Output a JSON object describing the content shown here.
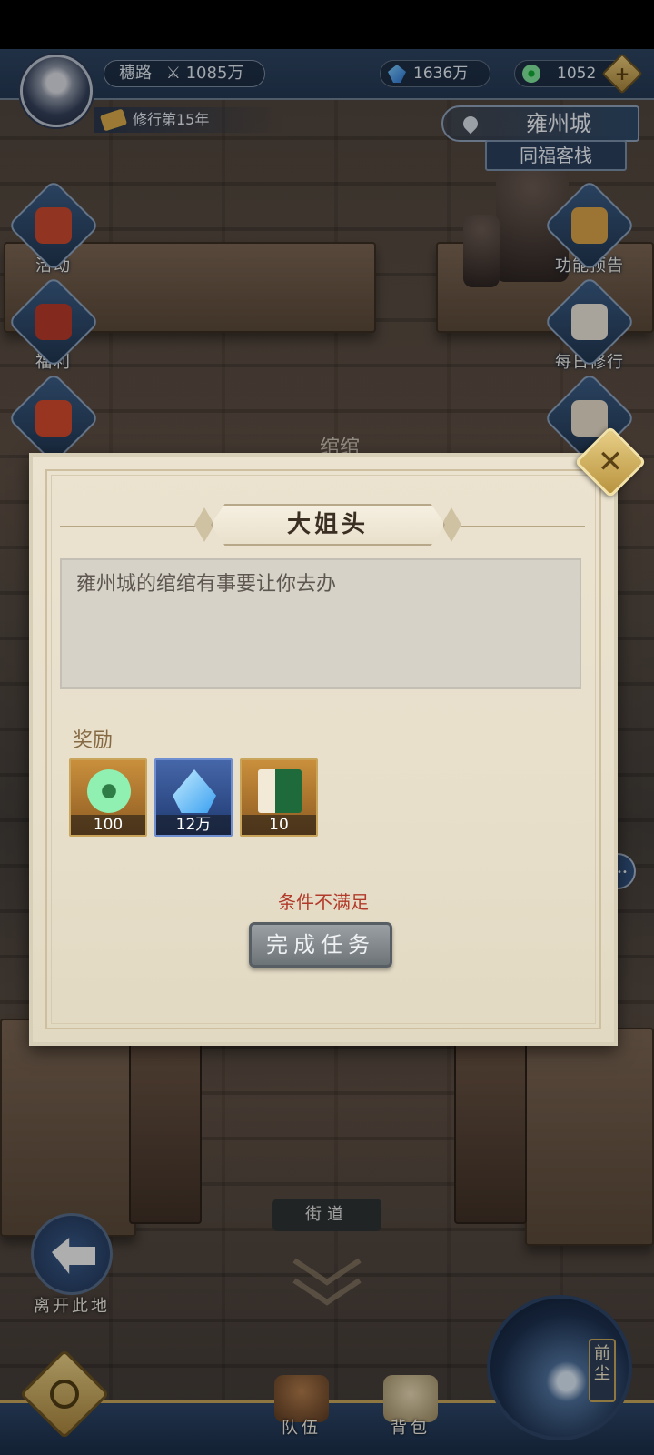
{
  "hud": {
    "player_name": "穗路",
    "power": "1085万",
    "spirit_stones": "1636万",
    "jade": "1052",
    "cultivation_year": "修行第15年",
    "location_city": "雍州城",
    "location_place": "同福客栈"
  },
  "side_menu": {
    "left": [
      {
        "label": "活动"
      },
      {
        "label": "福利"
      }
    ],
    "right": [
      {
        "label": "功能预告"
      },
      {
        "label": "每日修行"
      }
    ]
  },
  "scene": {
    "npc_name": "绾绾",
    "street_sign": "街道",
    "leave_label": "离开此地"
  },
  "dialog": {
    "title": "大姐头",
    "message": "雍州城的绾绾有事要让你去办",
    "reward_label": "奖励",
    "rewards": [
      {
        "icon": "jade-icon",
        "count": "100"
      },
      {
        "icon": "crystal-icon",
        "count": "12万"
      },
      {
        "icon": "book-icon",
        "count": "10"
      }
    ],
    "condition": "条件不满足",
    "complete_button": "完成任务"
  },
  "bottom_bar": {
    "team_label": "队伍",
    "bag_label": "背包",
    "orb_label": "前尘"
  },
  "colors": {
    "hud_blue": "#2e4460",
    "gold": "#c7a55c",
    "condition_red": "#b23a2a",
    "parchment": "#ebe3cf"
  }
}
